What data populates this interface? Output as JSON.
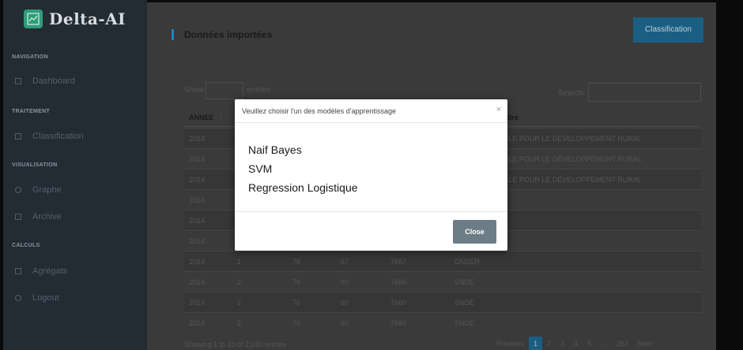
{
  "sidebar": {
    "brand": "Delta-AI",
    "sections": {
      "navigation": "NAVIGATION",
      "traitement": "TRAITEMENT",
      "visualisation": "VISUALISATION",
      "calculs": "CALCULS"
    },
    "items": {
      "dashboard": "Dashboard",
      "classification": "Classification",
      "graphe": "Graphe",
      "archive": "Archive",
      "agregats": "Agrégats",
      "logout": "Logout"
    }
  },
  "header": {
    "title": "Données importées",
    "classification_button": "Classification"
  },
  "table_controls": {
    "show_label": "Show",
    "entries_label": "entries",
    "search_label": "Search:"
  },
  "table": {
    "headers": [
      "ANNEE",
      "itre"
    ],
    "rows": [
      [
        "2014",
        "",
        "",
        "",
        "",
        "CIETE NATIONALE POUR LE DÉVELOPPEMENT RURAL"
      ],
      [
        "2014",
        "",
        "",
        "",
        "",
        "CIETE NATIONALE POUR LE DÉVELOPPEMENT RURAL"
      ],
      [
        "2014",
        "",
        "",
        "",
        "",
        "CIETE NATIONALE POUR LE DÉVELOPPEMENT RURAL"
      ],
      [
        "2014",
        "",
        "",
        "",
        "",
        "TIONALE"
      ],
      [
        "2014",
        "",
        "",
        "",
        "",
        "TIONALE"
      ],
      [
        "2014",
        "",
        "",
        "",
        "",
        ""
      ],
      [
        "2014",
        "1",
        "76",
        "67",
        "7667",
        "ONSER"
      ],
      [
        "2014",
        "2",
        "76",
        "60",
        "7660",
        "SNDE"
      ],
      [
        "2014",
        "2",
        "76",
        "60",
        "7660",
        "SNDE"
      ],
      [
        "2014",
        "2",
        "76",
        "60",
        "7660",
        "SNDE"
      ]
    ],
    "footer_showing": "Showing 1 to 10 of 2,630 entries",
    "pagination": [
      "Previous",
      "1",
      "2",
      "3",
      "4",
      "5",
      "...",
      "263",
      "Next"
    ],
    "active_page": "1"
  },
  "modal": {
    "title": "Veuillez choisir l'un des modèles d'apprentissage",
    "close_x": "×",
    "models": [
      "Naif Bayes",
      "SVM",
      "Regression Logistique"
    ],
    "close_button": "Close"
  },
  "colors": {
    "accent": "#1b5e83",
    "brand_green": "#2f9c79",
    "sidebar_bg": "#232b33",
    "close_button": "#6c7d87"
  }
}
